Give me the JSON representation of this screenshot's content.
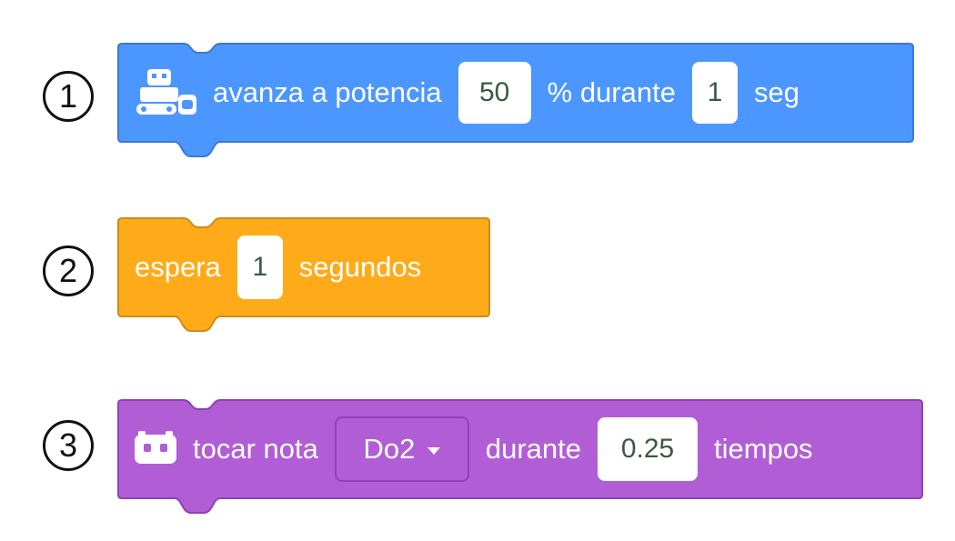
{
  "colors": {
    "motion": "#4c97ff",
    "control": "#ffab19",
    "sound": "#b15ed6"
  },
  "blocks": [
    {
      "number": "1",
      "icon": "robot-car-icon",
      "text_before": "avanza a potencia",
      "power_value": "50",
      "text_middle": "% durante",
      "time_value": "1",
      "text_after": "seg"
    },
    {
      "number": "2",
      "text_before": "espera",
      "value": "1",
      "text_after": "segundos"
    },
    {
      "number": "3",
      "icon": "robot-face-icon",
      "text_before": "tocar nota",
      "note_selected": "Do2",
      "text_middle": "durante",
      "beats_value": "0.25",
      "text_after": "tiempos"
    }
  ]
}
